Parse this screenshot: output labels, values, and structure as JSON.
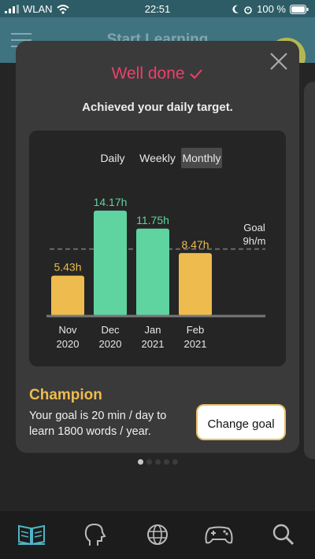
{
  "status_bar": {
    "carrier": "WLAN",
    "time": "22:51",
    "battery": "100 %"
  },
  "header": {
    "title": "Start Learning"
  },
  "modal": {
    "heading": "Well done",
    "subtitle": "Achieved your daily target.",
    "tabs": [
      {
        "label": "Daily",
        "active": false
      },
      {
        "label": "Weekly",
        "active": false
      },
      {
        "label": "Monthly",
        "active": true
      }
    ],
    "level": "Champion",
    "goal_text": "Your goal is 20 min / day to learn 1800 words / year.",
    "change_goal_label": "Change goal"
  },
  "chart_data": {
    "type": "bar",
    "categories": [
      "Nov 2020",
      "Dec 2020",
      "Jan 2021",
      "Feb 2021"
    ],
    "category_lines": [
      [
        "Nov",
        "2020"
      ],
      [
        "Dec",
        "2020"
      ],
      [
        "Jan",
        "2021"
      ],
      [
        "Feb",
        "2021"
      ]
    ],
    "values": [
      5.43,
      14.17,
      11.75,
      8.47
    ],
    "value_labels": [
      "5.43h",
      "14.17h",
      "11.75h",
      "8.47h"
    ],
    "goal": 9,
    "goal_label": [
      "Goal",
      "9h/m"
    ],
    "ylim": [
      0,
      15
    ],
    "colors": {
      "above_goal": "#5fd3a0",
      "below_goal": "#eebc4e"
    }
  },
  "pagination": {
    "count": 5,
    "active_index": 0
  },
  "tab_bar": {
    "icons": [
      "book-icon",
      "head-icon",
      "globe-icon",
      "gamepad-icon",
      "search-icon"
    ],
    "active_color": "#4fb4c7",
    "inactive_color": "#bbbbbb"
  }
}
